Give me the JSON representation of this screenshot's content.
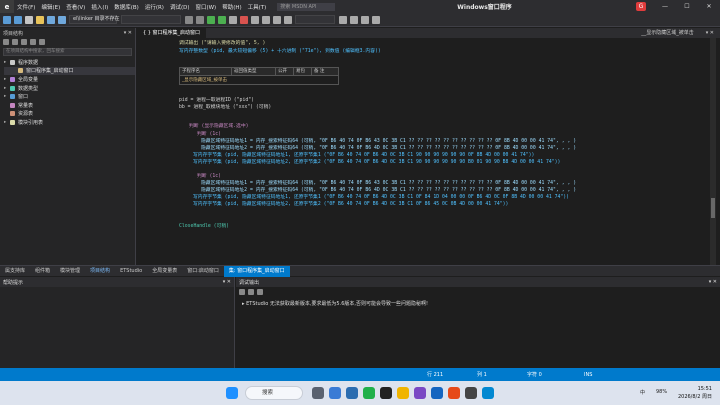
{
  "menubar": {
    "items": [
      "文件(F)",
      "编辑(E)",
      "查看(V)",
      "插入(I)",
      "数据库(B)",
      "运行(R)",
      "调试(D)",
      "窗口(W)",
      "帮助(H)",
      "工具(T)"
    ],
    "search_placeholder": "搜索 MSDN API",
    "window_title": "Windows窗口程序",
    "badge": "G",
    "btn_min": "—",
    "btn_max": "☐",
    "btn_close": "✕"
  },
  "toolbar": {
    "linker_select": "el\\linker 目录不存在",
    "target_select": "",
    "second_select": ""
  },
  "leftpanel": {
    "title": "项目结构",
    "pin": "▾ ✕",
    "search_placeholder": "在项目结构中搜索，回车搜索",
    "tree": [
      {
        "label": "程序数据",
        "arrow": "▸",
        "color": "#c8c8c8",
        "indent": 0,
        "selected": false
      },
      {
        "label": "窗口程序集_启动窗口",
        "arrow": "",
        "color": "#d7ba7d",
        "indent": 1,
        "selected": true
      },
      {
        "label": "全局变量",
        "arrow": "▸",
        "color": "#b180d7",
        "indent": 0,
        "selected": false
      },
      {
        "label": "数据类型",
        "arrow": "▸",
        "color": "#4ec9b0",
        "indent": 0,
        "selected": false
      },
      {
        "label": "窗口",
        "arrow": "▸",
        "color": "#569cd6",
        "indent": 0,
        "selected": false
      },
      {
        "label": "常量表",
        "arrow": "",
        "color": "#c586c0",
        "indent": 0,
        "selected": false
      },
      {
        "label": "资源表",
        "arrow": "",
        "color": "#ce9178",
        "indent": 0,
        "selected": false
      },
      {
        "label": "模块引用表",
        "arrow": "▸",
        "color": "#dcdcaa",
        "indent": 0,
        "selected": false
      }
    ]
  },
  "tabs": {
    "left_tab": "{ } 窗口程序集_启动窗口",
    "right_tab": "__显示隐藏区域_被单击",
    "close": "▾ ✕"
  },
  "code": {
    "line1": "调试输出 (\"请输入要修改的值\", 5, )",
    "line2": "写内存整数型 (pid, 最大较短偏移 (5) + 十六进制 (\"71e\"), 到数值 (编辑框3.内容))",
    "table_headers": [
      "子程序名",
      "返回值类型",
      "公开",
      "易包",
      "备 注"
    ],
    "table_row": "_显示隐藏区域_被单击",
    "l_pid": "pid = 进程一取进程ID (\"pid\")",
    "l_bb": "bb = 进程_取模块地址 (\"xxx\")  (可稍)",
    "if_line": "判断 (显示隐藏区域.选中)",
    "if_check": "判断 (1c)",
    "addr_lines": [
      "隐藏区域特征码地址1 = 内存_搜索特征码64 (可稍, \"0F B6 40 74 0F B6 43 0C 3B C1 ?? ?? ?? ?? ?? ?? ?? ?? ?? ?? 0F 8B 4D 00 00 41 74\", , , )",
      "隐藏区域特征码地址2 = 内存_搜索特征码64 (可稍, \"0F B6 40 74 0F B6 4D 0C 3B C1 ?? ?? ?? ?? ?? ?? ?? ?? ?? ?? 0F 8B 4D 00 00 41 74\", , , )"
    ],
    "write_lines": [
      "写内存字节集 (pid, 隐藏区域特征码地址1, 还原字节集1 (\"0F B6 40 74 0F B6 4D 0C 3B C1 90 90 90 90 90 90 0F 8B 4D 00 00 41 74\"))",
      "写内存字节集 (pid, 隐藏区域特征码地址2, 还原字节集2 (\"0F B6 40 74 0F B6 4D 0C 3B C1 90 90 90 90 90 90 B0 01 90 90 B8 4D 00 00 41 74\"))"
    ],
    "else_check": "判断 (1c)",
    "addr_lines2": [
      "隐藏区域特征码地址1 = 内存_搜索特征码64 (可稍, \"0F B6 40 74 0F B6 43 0C 3B C1 ?? ?? ?? ?? ?? ?? ?? ?? ?? ?? 0F 8B 4D 00 00 41 74\", , , )",
      "隐藏区域特征码地址2 = 内存_搜索特征码64 (可稍, \"0F B6 40 74 0F B6 4D 0C 3B C1 ?? ?? ?? ?? ?? ?? ?? ?? ?? ?? 0F 8B 4D 00 00 41 74\", , , )"
    ],
    "write_lines2": [
      "写内存字节集 (pid, 隐藏区域特征码地址1, 还原字节集1 (\"0F B6 40 74 0F B6 4D 0C 3B C1 0F 84 1D 04 00 00 0F B6 4D 0C 0F 8B 4D 00 00 41 74\"))",
      "写内存字节集 (pid, 隐藏区域特征码地址2, 还原字节集2 (\"0F B6 40 74 0F B6 4D 0C 3B C1 0F 86 45 0C 0B 4D 00 00 41 74\"))"
    ],
    "close_line": "CloseHandle (可稍)"
  },
  "midtabs": [
    "属支持库",
    "组件箱",
    "模块管理",
    "项目结构",
    "ETStudio",
    "全局变量表",
    "窗口:启动窗口",
    "集: 窗口程序集_启动窗口"
  ],
  "help": {
    "title": "帮助提示",
    "pin": "▾ ✕"
  },
  "output": {
    "title": "调试输出",
    "pin": "▾ ✕",
    "line": "ETStudio 无法获取最新版本,要求最低为5.6版本,否则可能会导致一些问题隐秘啊!"
  },
  "status": {
    "line": "行 211",
    "col": "列 1",
    "chars": "字符 0",
    "mode": "INS"
  },
  "taskbar": {
    "search": "搜索",
    "weather": "",
    "lang": "中",
    "battery": "98%",
    "time": "15:51",
    "date": "2026/8/2 周日"
  }
}
